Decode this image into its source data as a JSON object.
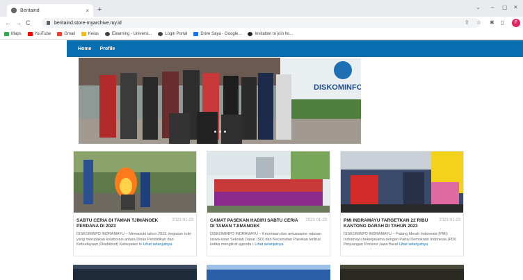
{
  "browser": {
    "tab_title": "Beritaind",
    "tab_close": "×",
    "new_tab": "+",
    "win_dropdown": "⌄",
    "win_min": "–",
    "win_max": "▢",
    "win_close": "✕",
    "nav_back": "←",
    "nav_forward": "→",
    "nav_reload": "C",
    "url": "beritaind.store-myarchive.my.id",
    "profile_initial": "F",
    "share_glyph": "⇪",
    "star_glyph": "☆",
    "extension_glyph": "✱",
    "sidepanel_glyph": "▯"
  },
  "bookmarks": [
    {
      "label": "Maps",
      "color": "#34a853",
      "icon": "map-pin-icon"
    },
    {
      "label": "YouTube",
      "color": "#ff0000",
      "icon": "youtube-icon"
    },
    {
      "label": "Gmail",
      "color": "#ea4335",
      "icon": "gmail-icon"
    },
    {
      "label": "Kelas",
      "color": "#fbbc04",
      "icon": "classroom-icon"
    },
    {
      "label": "Elearning - Universi...",
      "color": "#3c4043",
      "icon": "globe-icon"
    },
    {
      "label": "Login Portal",
      "color": "#3c4043",
      "icon": "globe-icon"
    },
    {
      "label": "Drive Saya - Google...",
      "color": "#1a73e8",
      "icon": "drive-icon"
    },
    {
      "label": "Invitation to join ho...",
      "color": "#202124",
      "icon": "github-icon"
    }
  ],
  "sitenav": {
    "home": "Home",
    "profile": "Profile"
  },
  "hero": {
    "sign_text": "DISKOMINFO"
  },
  "cards": [
    {
      "title": "SABTU CERIA DI TAMAN TJIMANOEK PERDANA DI 2023",
      "date": "2023-01-23",
      "excerpt": "DISKOMINFO INDRAMAYU – Memasuki tahun 2023, kegiatan rutin yang merupakan kolaborasi antara Dinas Pendidikan dan Kebudayaan (Disdikbud) Kabupaten In",
      "more": "Lihat selanjutnya"
    },
    {
      "title": "CAMAT PASEKAN HADIRI SABTU CERIA DI TAMAN TJIMANOEK",
      "date": "2023-01-23",
      "excerpt": "DISKOMINFO INDRAMAYU – Keceriaan dan antusiasme ratusan siswa-siswi Sekolah Dasar (SD) dan Kecamatan Pasekan terlihat ketika mengikuti agenda r",
      "more": "Lihat selanjutnya"
    },
    {
      "title": "PMI INDRAMAYU TARGETKAN 22 RIBU KANTONG DARAH DI TAHUN 2023",
      "date": "2023-01-23",
      "excerpt": "DISKOMINFO INDRAMAYU – Palang Merah Indonesia (PMI) Indramayu bekerjasama dengan Partai Demokrasi Indonesia (PDI) Perjuangan Provinsi Jawa Barat",
      "more": "Lihat selanjutnya"
    }
  ]
}
